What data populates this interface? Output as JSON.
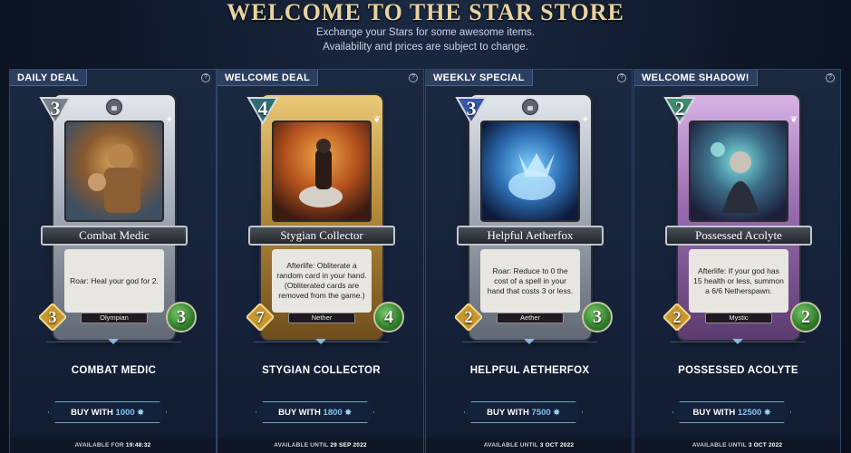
{
  "header": {
    "title": "WELCOME TO THE STAR STORE",
    "subtitle_line1": "Exchange your Stars for some awesome items.",
    "subtitle_line2": "Availability and prices are subject to change."
  },
  "help_glyph": "?",
  "buy_prefix": "BUY WITH",
  "offers": [
    {
      "deal_label": "DAILY DEAL",
      "card": {
        "name": "Combat Medic",
        "mana": "3",
        "attack": "3",
        "health": "3",
        "tribe": "Olympian",
        "text": "Roar: Heal your god for 2."
      },
      "item_name": "COMBAT MEDIC",
      "price": "1000",
      "availability_label": "AVAILABLE FOR",
      "availability_value": "19:48:32"
    },
    {
      "deal_label": "WELCOME DEAL",
      "card": {
        "name": "Stygian Collector",
        "mana": "4",
        "attack": "7",
        "health": "4",
        "tribe": "Nether",
        "text": "Afterlife: Obliterate a random card in your hand. (Obliterated cards are removed from the game.)"
      },
      "item_name": "STYGIAN COLLECTOR",
      "price": "1800",
      "availability_label": "AVAILABLE UNTIL",
      "availability_value": "29 SEP 2022"
    },
    {
      "deal_label": "WEEKLY SPECIAL",
      "card": {
        "name": "Helpful Aetherfox",
        "mana": "3",
        "attack": "2",
        "health": "3",
        "tribe": "Aether",
        "text": "Roar: Reduce to 0 the cost of a spell in your hand that costs 3 or less."
      },
      "item_name": "HELPFUL AETHERFOX",
      "price": "7500",
      "availability_label": "AVAILABLE UNTIL",
      "availability_value": "3 OCT 2022"
    },
    {
      "deal_label": "WELCOME SHADOW!",
      "card": {
        "name": "Possessed Acolyte",
        "mana": "2",
        "attack": "2",
        "health": "2",
        "tribe": "Mystic",
        "text": "Afterlife: If your god has 15 health or less, summon a 6/6 Netherspawn."
      },
      "item_name": "POSSESSED ACOLYTE",
      "price": "12500",
      "availability_label": "AVAILABLE UNTIL",
      "availability_value": "3 OCT 2022"
    }
  ]
}
